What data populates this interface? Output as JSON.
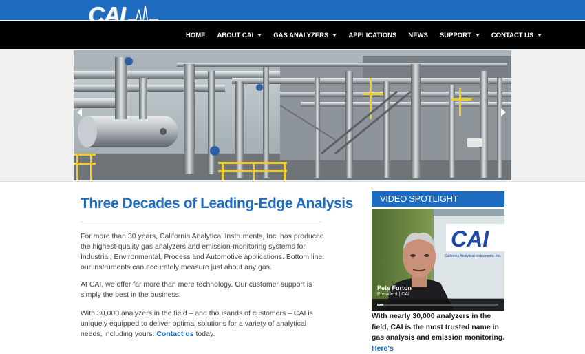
{
  "site": {
    "logo_text": "CAI"
  },
  "nav": {
    "items": [
      {
        "label": "HOME",
        "dropdown": false
      },
      {
        "label": "ABOUT CAI",
        "dropdown": true
      },
      {
        "label": "GAS ANALYZERS",
        "dropdown": true
      },
      {
        "label": "APPLICATIONS",
        "dropdown": false
      },
      {
        "label": "NEWS",
        "dropdown": false
      },
      {
        "label": "SUPPORT",
        "dropdown": true
      },
      {
        "label": "CONTACT US",
        "dropdown": true
      }
    ]
  },
  "main": {
    "headline": "Three Decades of Leading-Edge Analysis",
    "p1": "For more than 30 years, California Analytical Instruments, Inc. has produced the highest-quality gas analyzers and emission-monitoring systems for Industrial, Environmental, Process and Automotive applications. Bottom line: our instruments can accurately measure just about any gas.",
    "p2": "At CAI, we offer far more than mere technology. Our customer support is simply the best in the business.",
    "p3_before": "With 30,000 analyzers in the field – and thousands of customers – CAI is uniquely equipped to deliver optimal solutions for a variety of analytical needs, including yours. ",
    "p3_link": "Contact us",
    "p3_after": " today."
  },
  "video_spotlight": {
    "header": "VIDEO SPOTLIGHT",
    "person_name": "Pete Furton",
    "person_title": "President | CAI",
    "sign_text": "CAI",
    "sign_subtext": "California Analytical Instruments, Inc.",
    "progress": 0.05,
    "text": "With nearly 30,000 analyzers in the field, CAI is the most trusted name in gas analysis and emission monitoring. ",
    "text_link": "Here's"
  },
  "colors": {
    "brand_blue": "#1e6cc0",
    "nav_bg": "#000000",
    "body_text": "#444444"
  },
  "icons": {
    "slider_prev": "chevron-left-icon",
    "slider_next": "chevron-right-icon",
    "dropdown": "caret-down-icon"
  }
}
